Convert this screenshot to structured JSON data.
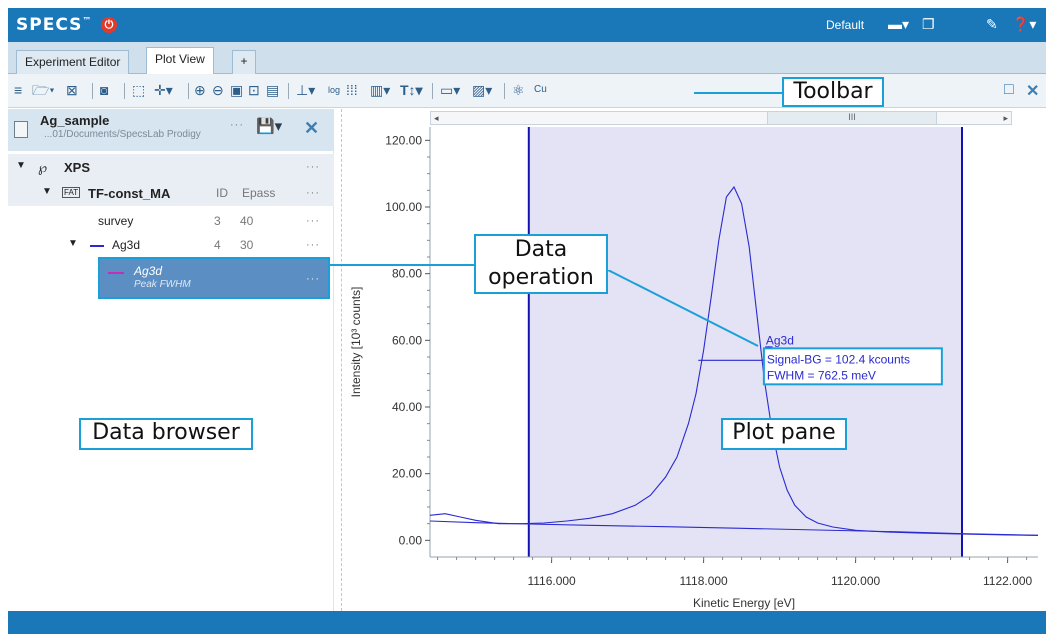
{
  "app": {
    "brand": "SPECS",
    "brand_mark": "™",
    "power_icon": "⏻",
    "profile": "Default"
  },
  "tabs": [
    {
      "label": "Experiment Editor"
    },
    {
      "label": "Plot View"
    },
    {
      "label": "+"
    }
  ],
  "toolbar": {
    "callout": "Toolbar"
  },
  "browser": {
    "title": "Ag_sample",
    "path": "...01/Documents/SpecsLab Prodigy",
    "more": "···",
    "tree": {
      "group": "XPS",
      "method_tag": "FAT",
      "method": "TF-const_MA",
      "col_id": "ID",
      "col_epass": "Epass",
      "rows": [
        {
          "name": "survey",
          "id": "3",
          "epass": "40"
        },
        {
          "name": "Ag3d",
          "id": "4",
          "epass": "30"
        }
      ],
      "selected": {
        "title": "Ag3d",
        "subtitle": "Peak FWHM"
      }
    },
    "callout": "Data browser"
  },
  "data_operation_callout": {
    "line1": "Data",
    "line2": "operation"
  },
  "plot": {
    "callout": "Plot pane",
    "scroll_thumb": "III",
    "annotation": {
      "name": "Ag3d",
      "signal": "Signal-BG = 102.4 kcounts",
      "fwhm": "FWHM = 762.5 meV"
    }
  },
  "chart_data": {
    "type": "line",
    "xlabel": "Kinetic Energy [eV]",
    "ylabel": "Intensity [10³ counts]",
    "xlim": [
      1114.4,
      1122.4
    ],
    "ylim": [
      -5,
      124
    ],
    "xticks": [
      "1116.000",
      "1118.000",
      "1120.000",
      "1122.000"
    ],
    "xtick_values": [
      1116,
      1118,
      1120,
      1122
    ],
    "yticks": [
      "0.00",
      "20.00",
      "40.00",
      "60.00",
      "80.00",
      "100.00",
      "120.00"
    ],
    "ytick_values": [
      0,
      20,
      40,
      60,
      80,
      100,
      120
    ],
    "region": [
      1115.7,
      1121.4
    ],
    "fwhm_bar": {
      "x1": 1117.93,
      "x2": 1118.78,
      "y": 54
    },
    "series": [
      {
        "color": "#2a2ad0",
        "x": [
          1114.4,
          1114.6,
          1114.8,
          1115.0,
          1115.3,
          1115.6,
          1115.9,
          1116.2,
          1116.5,
          1116.8,
          1117.1,
          1117.3,
          1117.5,
          1117.65,
          1117.8,
          1117.9,
          1118.0,
          1118.1,
          1118.2,
          1118.3,
          1118.4,
          1118.5,
          1118.6,
          1118.7,
          1118.8,
          1118.9,
          1119.0,
          1119.1,
          1119.2,
          1119.35,
          1119.5,
          1119.7,
          1120.0,
          1120.4,
          1120.8,
          1121.2,
          1121.6,
          1122.0,
          1122.4
        ],
        "y": [
          7.5,
          8,
          7,
          6,
          5,
          5,
          5.2,
          5.8,
          6.6,
          8,
          10.5,
          13.5,
          19,
          25,
          35,
          44,
          57,
          73,
          90,
          103,
          106,
          101,
          88,
          68,
          48,
          33,
          22,
          15,
          10.5,
          7,
          5.2,
          4,
          3,
          2.5,
          2.2,
          2,
          1.8,
          1.6,
          1.5
        ]
      },
      {
        "name": "background",
        "color": "#2a2ad0",
        "x": [
          1114.4,
          1115.0,
          1115.7,
          1116.5,
          1117.5,
          1118.5,
          1119.5,
          1120.5,
          1121.4,
          1122.4
        ],
        "y": [
          5.8,
          5.3,
          4.9,
          4.5,
          4.1,
          3.6,
          3.1,
          2.6,
          2.0,
          1.5
        ]
      }
    ]
  },
  "colors": {
    "accent": "#1a78b8",
    "callout_border": "#1aa0d8",
    "curve": "#2a2ad0",
    "region": "#e4e3f5",
    "region_edge": "#1212b4",
    "selection": "#5b8fc4"
  }
}
